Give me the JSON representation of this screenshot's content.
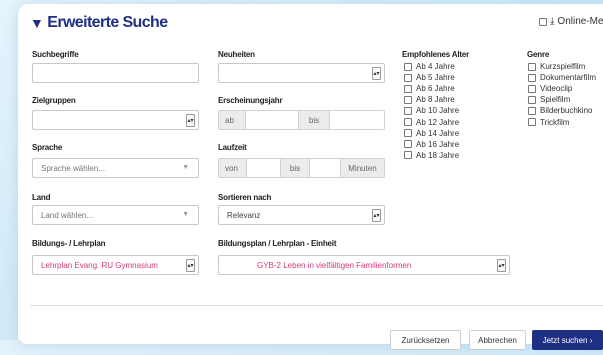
{
  "dialog": {
    "title": "Erweiterte Suche",
    "online_media_label": "Online-Medien"
  },
  "fields": {
    "suchbegriffe": {
      "label": "Suchbegriffe",
      "value": ""
    },
    "neuheiten": {
      "label": "Neuheiten",
      "value": ""
    },
    "zielgruppen": {
      "label": "Zielgruppen",
      "value": ""
    },
    "erscheinungsjahr": {
      "label": "Erscheinungsjahr",
      "from": "ab",
      "to": "bis"
    },
    "sprache": {
      "label": "Sprache",
      "placeholder": "Sprache wählen..."
    },
    "laufzeit": {
      "label": "Laufzeit",
      "from": "von",
      "to": "bis",
      "unit": "Minuten"
    },
    "land": {
      "label": "Land",
      "placeholder": "Land wählen..."
    },
    "sortieren": {
      "label": "Sortieren nach",
      "value": "Relevanz"
    },
    "bildungsplan": {
      "label": "Bildungs- / Lehrplan",
      "value": "Lehrplan Evang. RU Gymnasium"
    },
    "einheit": {
      "label": "Bildungsplan / Lehrplan - Einheit",
      "value": "GYB-2 Leben in vielfältigen Familienformen"
    }
  },
  "alter": {
    "label": "Empfohlenes Alter",
    "items": [
      "Ab 4 Jahre",
      "Ab 5 Jahre",
      "Ab 6 Jahre",
      "Ab 8 Jahre",
      "Ab 10 Jahre",
      "Ab 12 Jahre",
      "Ab 14 Jahre",
      "Ab 16 Jahre",
      "Ab 18 Jahre"
    ]
  },
  "genre": {
    "label": "Genre",
    "items": [
      "Kurzspielfilm",
      "Dokumentarfilm",
      "Videoclip",
      "Spielfilm",
      "Bilderbuchkino",
      "Trickfilm"
    ]
  },
  "buttons": {
    "reset": "Zurücksetzen",
    "cancel": "Abbrechen",
    "submit": "Jetzt suchen ›"
  },
  "colors": {
    "brand": "#1f2f84",
    "accent_pink": "#d63a7b"
  }
}
